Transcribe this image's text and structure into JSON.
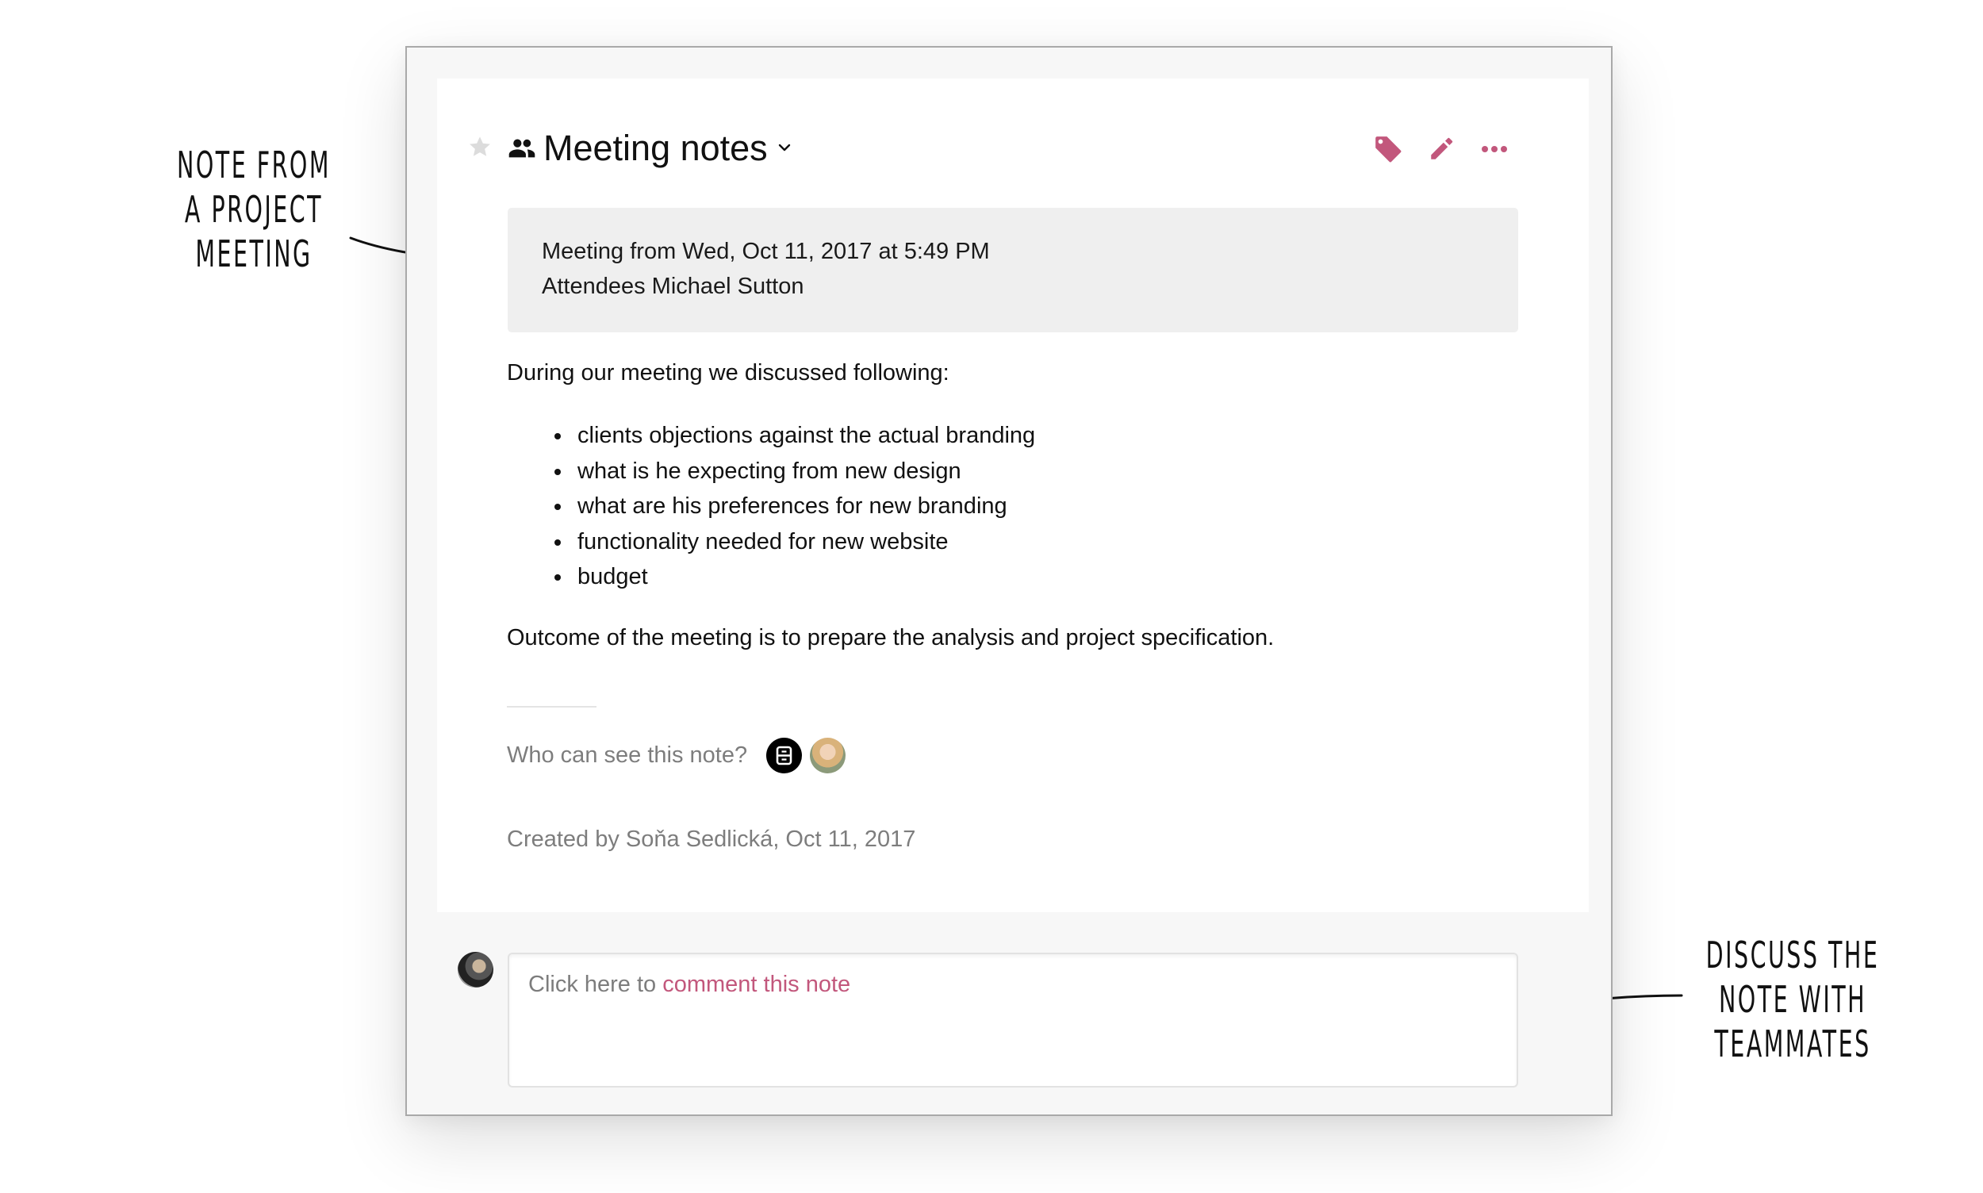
{
  "note": {
    "title": "Meeting notes",
    "starred": false,
    "shared": true,
    "header_actions": [
      {
        "name": "tag",
        "icon": "tag-icon"
      },
      {
        "name": "edit",
        "icon": "pencil-icon"
      },
      {
        "name": "more",
        "icon": "more-horizontal-icon"
      }
    ],
    "meeting_info": {
      "line1": "Meeting from Wed, Oct 11, 2017 at 5:49 PM",
      "line2": "Attendees Michael Sutton"
    },
    "intro": "During our meeting we discussed following:",
    "bullets": [
      "clients objections against the actual branding",
      "what is he expecting from new design",
      "what are his preferences for new branding",
      "functionality needed for new website",
      "budget"
    ],
    "outcome": "Outcome of the meeting is to prepare the analysis and project specification.",
    "visibility_label": "Who can see this note?",
    "visibility_avatars": [
      {
        "kind": "team",
        "icon": "cabinet-icon"
      },
      {
        "kind": "person",
        "icon": "user-avatar"
      }
    ],
    "created_by": "Created by Soňa Sedlická, Oct 11, 2017"
  },
  "comment": {
    "prefix": "Click here to ",
    "link": "comment this note"
  },
  "annotations": {
    "left": [
      "Note from",
      "a project",
      "meeting"
    ],
    "right": [
      "Discuss the",
      "note with",
      "teammates"
    ]
  },
  "colors": {
    "accent": "#c2577c",
    "muted_text": "#7d7d7d",
    "info_box_bg": "#efefef",
    "panel_bg": "#f7f7f7"
  }
}
